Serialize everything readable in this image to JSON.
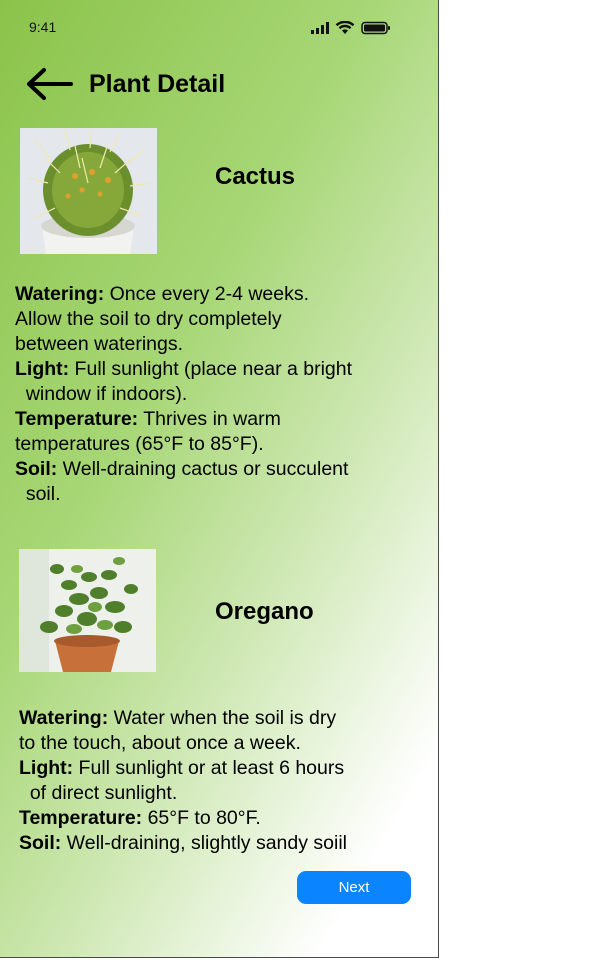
{
  "status_bar": {
    "time": "9:41"
  },
  "header": {
    "title": "Plant Detail",
    "back_icon": "arrow-left-icon"
  },
  "plants": [
    {
      "name": "Cactus",
      "details": [
        {
          "label": "Watering:",
          "text": " Once every 2-4 weeks."
        },
        {
          "label": "",
          "text": "Allow the soil to dry completely"
        },
        {
          "label": "",
          "text": "between waterings."
        },
        {
          "label": "Light:",
          "text": " Full sunlight (place near a bright"
        },
        {
          "label": "",
          "text": "  window if indoors)."
        },
        {
          "label": "Temperature:",
          "text": " Thrives in warm"
        },
        {
          "label": "",
          "text": "temperatures (65°F to 85°F)."
        },
        {
          "label": "Soil:",
          "text": " Well-draining cactus or succulent"
        },
        {
          "label": "",
          "text": "  soil."
        }
      ]
    },
    {
      "name": "Oregano",
      "details": [
        {
          "label": "Watering:",
          "text": " Water when the soil is dry"
        },
        {
          "label": "",
          "text": "to the touch, about once a week."
        },
        {
          "label": "Light:",
          "text": " Full sunlight or at least 6 hours"
        },
        {
          "label": "",
          "text": "  of direct sunlight."
        },
        {
          "label": "Temperature:",
          "text": " 65°F to 80°F."
        },
        {
          "label": "Soil:",
          "text": " Well-draining, slightly sandy soiil"
        }
      ]
    }
  ],
  "actions": {
    "next_label": "Next",
    "accent": "#0a84ff"
  }
}
